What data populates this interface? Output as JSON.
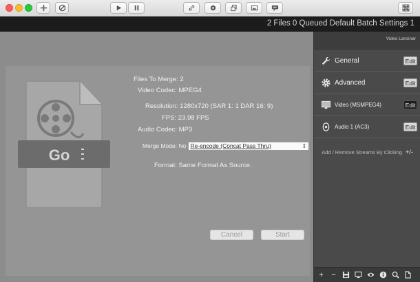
{
  "toolbar": {
    "buttons": [
      {
        "name": "add",
        "icon": "plus-icon"
      },
      {
        "name": "cancel",
        "icon": "no-entry-icon"
      },
      {
        "name": "play",
        "icon": "play-icon"
      },
      {
        "name": "pause",
        "icon": "pause-icon"
      },
      {
        "name": "link",
        "icon": "link-icon"
      },
      {
        "name": "record",
        "icon": "record-icon"
      },
      {
        "name": "copy",
        "icon": "copy-icon"
      },
      {
        "name": "image",
        "icon": "image-icon"
      },
      {
        "name": "chat",
        "icon": "chat-icon"
      },
      {
        "name": "pattern",
        "icon": "pattern-icon"
      }
    ]
  },
  "status": {
    "text": "2 Files 0 Queued Default Batch Settings 1"
  },
  "merge": {
    "files_to_merge": "Files To Merge: 2",
    "video_codec": "Video Codec: MPEG4",
    "resolution": "Resolution: 1280x720 (SAR 1: 1 DAR 16: 9)",
    "fps": "FPS: 23.98 FPS",
    "audio_codec": "Audio Codec: MP3",
    "merge_mode_label": "Merge Mode: No",
    "merge_mode_value": "Re-encode (Concat Pass Thru)",
    "format": "Format: Same Format As Source.",
    "cancel_label": "Cancel",
    "start_label": "Start",
    "icon_text": "Go"
  },
  "side": {
    "header": "Video Lansinar",
    "items": [
      {
        "name": "General",
        "icon": "wrench-icon",
        "edit": "Edit"
      },
      {
        "name": "Advanced",
        "icon": "gear-icon",
        "edit": "Edit"
      },
      {
        "name": "Video (MSMPEG4)",
        "icon": "monitor-icon",
        "edit": "Edit"
      },
      {
        "name": "Audio 1 (AC3)",
        "icon": "speaker-icon",
        "edit": "Edit"
      }
    ],
    "add_note": "Add / Remove Streams By Clicking",
    "add_hint": "+/-"
  },
  "side_toolbar": [
    {
      "name": "add",
      "icon": "plus-icon",
      "glyph": "+"
    },
    {
      "name": "remove",
      "icon": "minus-icon",
      "glyph": "−"
    },
    {
      "name": "save",
      "icon": "save-icon"
    },
    {
      "name": "display",
      "icon": "monitor-icon"
    },
    {
      "name": "preview",
      "icon": "eye-icon"
    },
    {
      "name": "info",
      "icon": "info-icon"
    },
    {
      "name": "search",
      "icon": "search-icon"
    },
    {
      "name": "document",
      "icon": "document-icon"
    }
  ]
}
